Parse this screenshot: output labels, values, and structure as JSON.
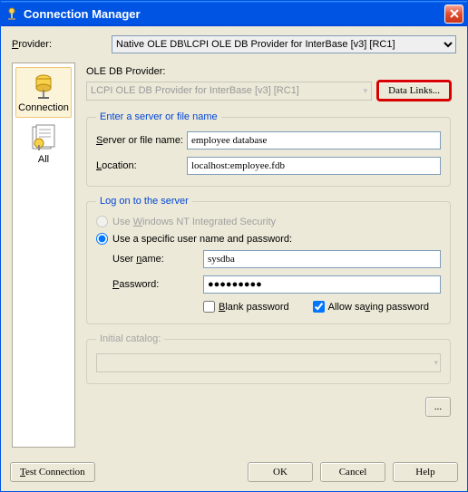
{
  "window": {
    "title": "Connection Manager"
  },
  "provider": {
    "label": "Provider:",
    "value": "Native OLE DB\\LCPI OLE DB Provider for InterBase [v3] [RC1]"
  },
  "sidebar": {
    "items": [
      {
        "label": "Connection"
      },
      {
        "label": "All"
      }
    ]
  },
  "ole": {
    "label": "OLE DB Provider:",
    "value": "LCPI OLE DB Provider for InterBase [v3] [RC1]",
    "data_links": "Data Links..."
  },
  "server_group": {
    "legend": "Enter a server or file name",
    "server_label": "Server or file name:",
    "server_value": "employee database",
    "location_label": "Location:",
    "location_value": "localhost:employee.fdb"
  },
  "logon_group": {
    "legend": "Log on to the server",
    "nt_label": "Use Windows NT Integrated Security",
    "specific_label": "Use a specific user name and password:",
    "user_label": "User name:",
    "user_value": "sysdba",
    "pass_label": "Password:",
    "pass_value": "●●●●●●●●●",
    "blank_label": "Blank password",
    "allow_label": "Allow saving password"
  },
  "initial": {
    "legend": "Initial catalog:"
  },
  "more_btn": "...",
  "footer": {
    "test": "Test Connection",
    "ok": "OK",
    "cancel": "Cancel",
    "help": "Help"
  }
}
